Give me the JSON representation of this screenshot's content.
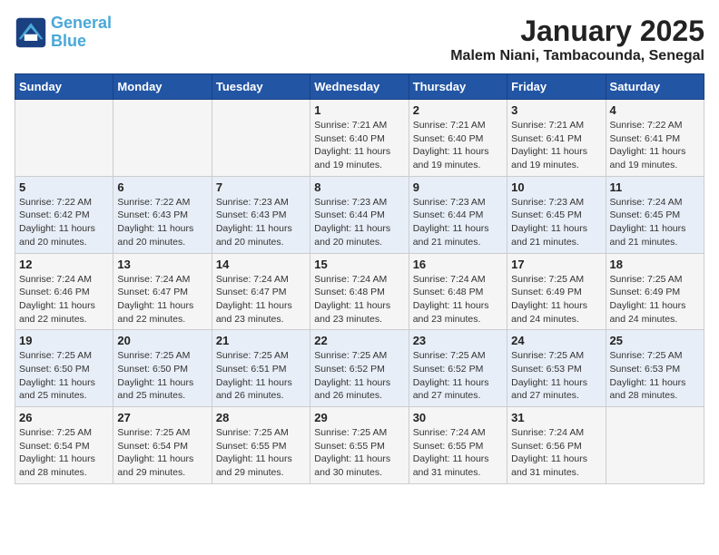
{
  "header": {
    "logo_line1": "General",
    "logo_line2": "Blue",
    "month": "January 2025",
    "location": "Malem Niani, Tambacounda, Senegal"
  },
  "weekdays": [
    "Sunday",
    "Monday",
    "Tuesday",
    "Wednesday",
    "Thursday",
    "Friday",
    "Saturday"
  ],
  "weeks": [
    [
      {
        "day": "",
        "info": ""
      },
      {
        "day": "",
        "info": ""
      },
      {
        "day": "",
        "info": ""
      },
      {
        "day": "1",
        "info": "Sunrise: 7:21 AM\nSunset: 6:40 PM\nDaylight: 11 hours and 19 minutes."
      },
      {
        "day": "2",
        "info": "Sunrise: 7:21 AM\nSunset: 6:40 PM\nDaylight: 11 hours and 19 minutes."
      },
      {
        "day": "3",
        "info": "Sunrise: 7:21 AM\nSunset: 6:41 PM\nDaylight: 11 hours and 19 minutes."
      },
      {
        "day": "4",
        "info": "Sunrise: 7:22 AM\nSunset: 6:41 PM\nDaylight: 11 hours and 19 minutes."
      }
    ],
    [
      {
        "day": "5",
        "info": "Sunrise: 7:22 AM\nSunset: 6:42 PM\nDaylight: 11 hours and 20 minutes."
      },
      {
        "day": "6",
        "info": "Sunrise: 7:22 AM\nSunset: 6:43 PM\nDaylight: 11 hours and 20 minutes."
      },
      {
        "day": "7",
        "info": "Sunrise: 7:23 AM\nSunset: 6:43 PM\nDaylight: 11 hours and 20 minutes."
      },
      {
        "day": "8",
        "info": "Sunrise: 7:23 AM\nSunset: 6:44 PM\nDaylight: 11 hours and 20 minutes."
      },
      {
        "day": "9",
        "info": "Sunrise: 7:23 AM\nSunset: 6:44 PM\nDaylight: 11 hours and 21 minutes."
      },
      {
        "day": "10",
        "info": "Sunrise: 7:23 AM\nSunset: 6:45 PM\nDaylight: 11 hours and 21 minutes."
      },
      {
        "day": "11",
        "info": "Sunrise: 7:24 AM\nSunset: 6:45 PM\nDaylight: 11 hours and 21 minutes."
      }
    ],
    [
      {
        "day": "12",
        "info": "Sunrise: 7:24 AM\nSunset: 6:46 PM\nDaylight: 11 hours and 22 minutes."
      },
      {
        "day": "13",
        "info": "Sunrise: 7:24 AM\nSunset: 6:47 PM\nDaylight: 11 hours and 22 minutes."
      },
      {
        "day": "14",
        "info": "Sunrise: 7:24 AM\nSunset: 6:47 PM\nDaylight: 11 hours and 23 minutes."
      },
      {
        "day": "15",
        "info": "Sunrise: 7:24 AM\nSunset: 6:48 PM\nDaylight: 11 hours and 23 minutes."
      },
      {
        "day": "16",
        "info": "Sunrise: 7:24 AM\nSunset: 6:48 PM\nDaylight: 11 hours and 23 minutes."
      },
      {
        "day": "17",
        "info": "Sunrise: 7:25 AM\nSunset: 6:49 PM\nDaylight: 11 hours and 24 minutes."
      },
      {
        "day": "18",
        "info": "Sunrise: 7:25 AM\nSunset: 6:49 PM\nDaylight: 11 hours and 24 minutes."
      }
    ],
    [
      {
        "day": "19",
        "info": "Sunrise: 7:25 AM\nSunset: 6:50 PM\nDaylight: 11 hours and 25 minutes."
      },
      {
        "day": "20",
        "info": "Sunrise: 7:25 AM\nSunset: 6:50 PM\nDaylight: 11 hours and 25 minutes."
      },
      {
        "day": "21",
        "info": "Sunrise: 7:25 AM\nSunset: 6:51 PM\nDaylight: 11 hours and 26 minutes."
      },
      {
        "day": "22",
        "info": "Sunrise: 7:25 AM\nSunset: 6:52 PM\nDaylight: 11 hours and 26 minutes."
      },
      {
        "day": "23",
        "info": "Sunrise: 7:25 AM\nSunset: 6:52 PM\nDaylight: 11 hours and 27 minutes."
      },
      {
        "day": "24",
        "info": "Sunrise: 7:25 AM\nSunset: 6:53 PM\nDaylight: 11 hours and 27 minutes."
      },
      {
        "day": "25",
        "info": "Sunrise: 7:25 AM\nSunset: 6:53 PM\nDaylight: 11 hours and 28 minutes."
      }
    ],
    [
      {
        "day": "26",
        "info": "Sunrise: 7:25 AM\nSunset: 6:54 PM\nDaylight: 11 hours and 28 minutes."
      },
      {
        "day": "27",
        "info": "Sunrise: 7:25 AM\nSunset: 6:54 PM\nDaylight: 11 hours and 29 minutes."
      },
      {
        "day": "28",
        "info": "Sunrise: 7:25 AM\nSunset: 6:55 PM\nDaylight: 11 hours and 29 minutes."
      },
      {
        "day": "29",
        "info": "Sunrise: 7:25 AM\nSunset: 6:55 PM\nDaylight: 11 hours and 30 minutes."
      },
      {
        "day": "30",
        "info": "Sunrise: 7:24 AM\nSunset: 6:55 PM\nDaylight: 11 hours and 31 minutes."
      },
      {
        "day": "31",
        "info": "Sunrise: 7:24 AM\nSunset: 6:56 PM\nDaylight: 11 hours and 31 minutes."
      },
      {
        "day": "",
        "info": ""
      }
    ]
  ]
}
